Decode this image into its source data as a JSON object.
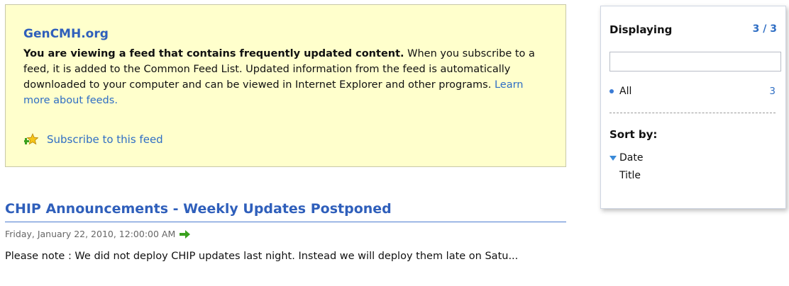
{
  "feed_info": {
    "site_title": "GenCMH.org",
    "bold_intro": "You are viewing a feed that contains frequently updated content.",
    "description": " When you subscribe to a feed, it is added to the Common Feed List. Updated information from the feed is automatically downloaded to your computer and can be viewed in Internet Explorer and other programs. ",
    "learn_more_link": "Learn more about feeds.",
    "subscribe_label": "Subscribe to this feed",
    "subscribe_icon": "star-plus-icon"
  },
  "article": {
    "title": "CHIP Announcements - Weekly Updates Postponed",
    "date": "Friday, January 22, 2010, 12:00:00 AM",
    "date_icon": "green-arrow-icon",
    "body": "Please note : We did not deploy CHIP updates last night.  Instead we will deploy them late on Satu..."
  },
  "panel": {
    "displaying_label": "Displaying",
    "displaying_count": "3 / 3",
    "search_value": "",
    "filter_all_label": "All",
    "filter_all_count": "3",
    "sort_label": "Sort by:",
    "sort_options": [
      "Date",
      "Title"
    ],
    "sort_selected": "Date"
  },
  "colors": {
    "link": "#2f6ec4",
    "title": "#2f5fbb",
    "infobox_bg": "#ffffcc",
    "arrow_green": "#3aa11e"
  }
}
